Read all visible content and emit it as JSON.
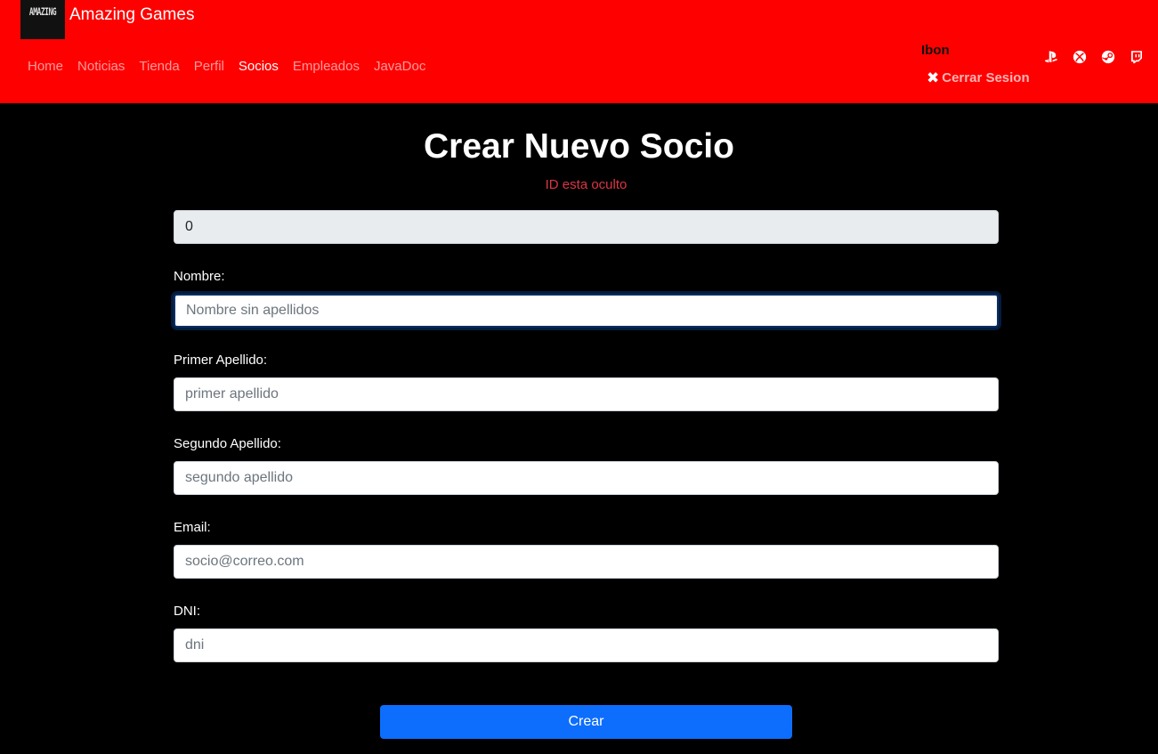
{
  "header": {
    "logo_text": "AMAZING",
    "brand": "Amazing Games",
    "nav": [
      {
        "label": "Home",
        "active": false
      },
      {
        "label": "Noticias",
        "active": false
      },
      {
        "label": "Tienda",
        "active": false
      },
      {
        "label": "Perfil",
        "active": false
      },
      {
        "label": "Socios",
        "active": true
      },
      {
        "label": "Empleados",
        "active": false
      },
      {
        "label": "JavaDoc",
        "active": false
      }
    ],
    "user": "Ibon",
    "logout_label": "Cerrar Sesion",
    "social": [
      "playstation-icon",
      "xbox-icon",
      "steam-icon",
      "twitch-icon"
    ],
    "accent": "#ff0000"
  },
  "page": {
    "title": "Crear Nuevo Socio",
    "id_note": "ID esta oculto"
  },
  "form": {
    "id_value": "0",
    "nombre_label": "Nombre:",
    "nombre_placeholder": "Nombre sin apellidos",
    "apellido1_label": "Primer Apellido:",
    "apellido1_placeholder": "primer apellido",
    "apellido2_label": "Segundo Apellido:",
    "apellido2_placeholder": "segundo apellido",
    "email_label": "Email:",
    "email_placeholder": "socio@correo.com",
    "dni_label": "DNI:",
    "dni_placeholder": "dni",
    "submit_label": "Crear"
  }
}
